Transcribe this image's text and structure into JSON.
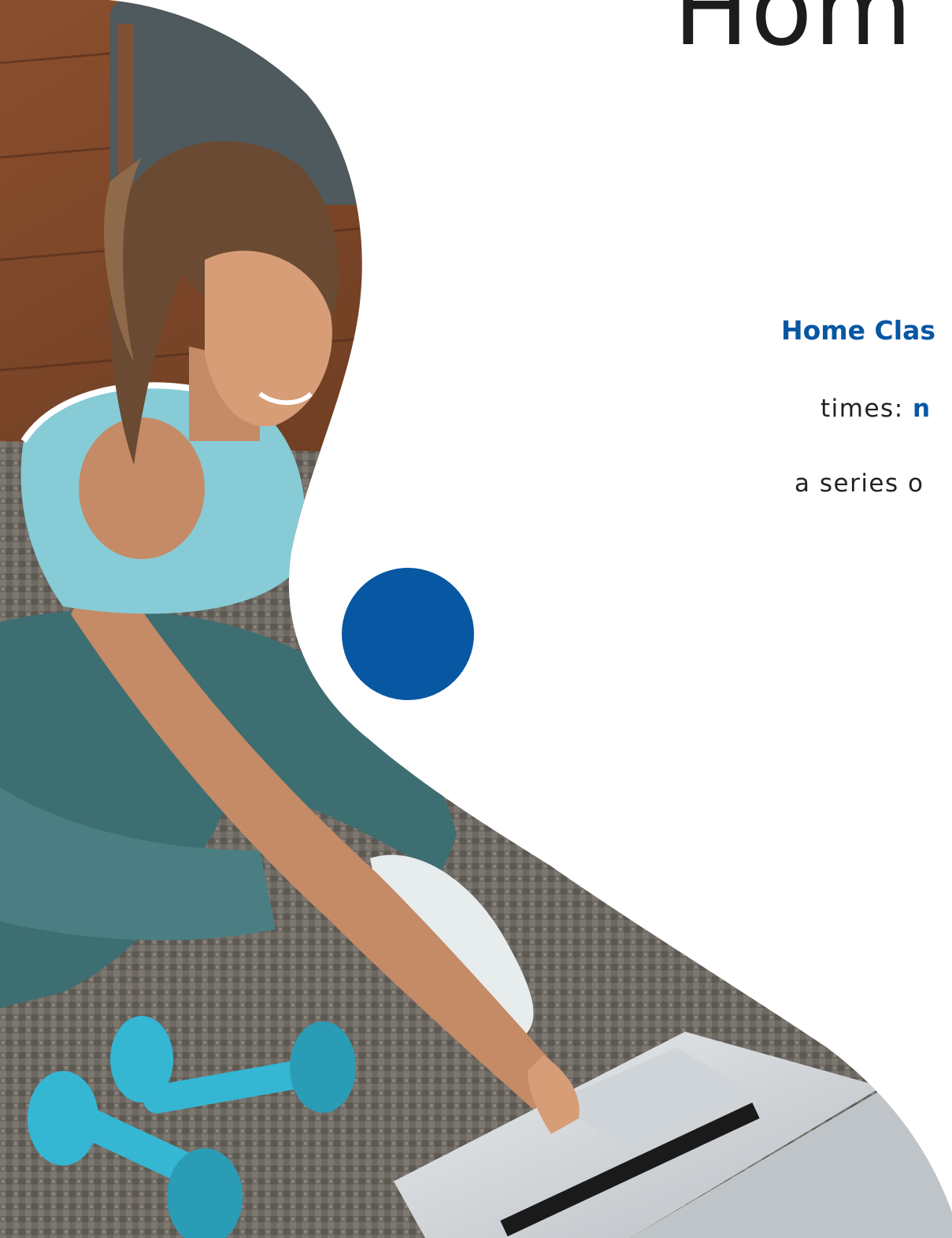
{
  "headline": "Hom",
  "subheading": "Home Clas",
  "times": {
    "label": "times:",
    "highlight": "n"
  },
  "series_text": "a series o",
  "colors": {
    "accent": "#0757a3",
    "text": "#1c1c1c",
    "dumbbell": "#35b6d3",
    "top": "#87cbd6",
    "leggings": "#3d6e72"
  },
  "photo_subject": "woman in workout clothes sitting on a mat with dumbbells, using a laptop"
}
